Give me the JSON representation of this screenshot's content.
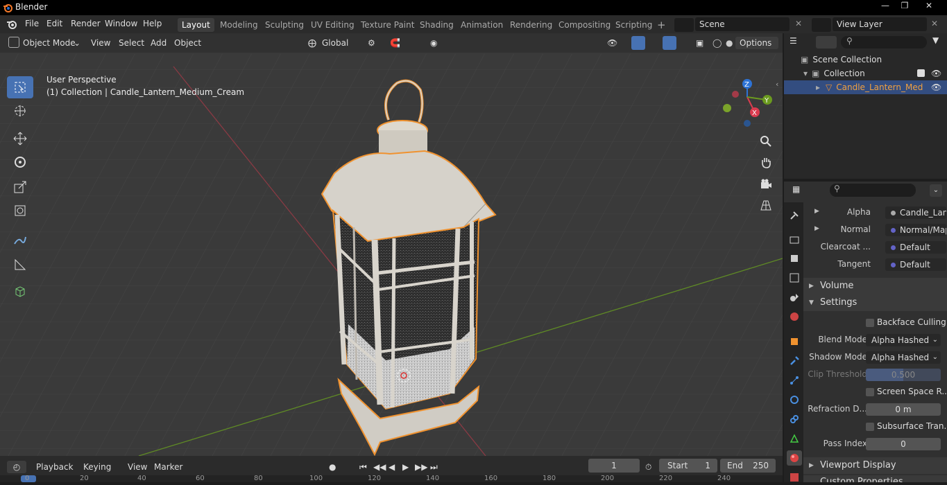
{
  "app": {
    "title": "Blender"
  },
  "menu": [
    "File",
    "Edit",
    "Render",
    "Window",
    "Help"
  ],
  "workspaces": [
    "Layout",
    "Modeling",
    "Sculpting",
    "UV Editing",
    "Texture Paint",
    "Shading",
    "Animation",
    "Rendering",
    "Compositing",
    "Scripting"
  ],
  "scene": {
    "name": "Scene",
    "view_layer": "View Layer"
  },
  "viewport": {
    "mode": "Object Mode",
    "menus": [
      "View",
      "Select",
      "Add",
      "Object"
    ],
    "transform_orientation": "Global",
    "options": "Options",
    "perspective_label": "User Perspective",
    "collection_label": "(1) Collection | Candle_Lantern_Medium_Cream"
  },
  "gizmo": {
    "x": "X",
    "y": "Y",
    "z": "Z"
  },
  "outliner": {
    "root": "Scene Collection",
    "collection": "Collection",
    "object": "Candle_Lantern_Med"
  },
  "properties": {
    "rows": [
      {
        "label": "Alpha",
        "value": "Candle_Lante..."
      },
      {
        "label": "Normal",
        "value": "Normal/Map"
      },
      {
        "label": "Clearcoat ...",
        "value": "Default"
      },
      {
        "label": "Tangent",
        "value": "Default"
      }
    ],
    "sections": {
      "volume": "Volume",
      "settings": "Settings",
      "viewport_display": "Viewport Display",
      "custom_properties": "Custom Properties"
    },
    "settings": {
      "backface_culling": "Backface Culling",
      "blend_mode_label": "Blend Mode",
      "blend_mode": "Alpha Hashed",
      "shadow_mode_label": "Shadow Mode",
      "shadow_mode": "Alpha Hashed",
      "clip_threshold_label": "Clip Threshold",
      "clip_threshold": "0.500",
      "ssr": "Screen Space R...",
      "refraction_label": "Refraction D...",
      "refraction": "0 m",
      "subsurface": "Subsurface Tran...",
      "pass_index_label": "Pass Index",
      "pass_index": "0"
    }
  },
  "timeline": {
    "playback": "Playback",
    "keying": "Keying",
    "view": "View",
    "marker": "Marker",
    "current_frame": "1",
    "start_label": "Start",
    "start": "1",
    "end_label": "End",
    "end": "250",
    "ticks": [
      "0",
      "20",
      "40",
      "60",
      "80",
      "100",
      "120",
      "140",
      "160",
      "180",
      "200",
      "220",
      "240"
    ]
  },
  "colors": {
    "accent": "#4772b3",
    "selection": "#f0922f",
    "x_axis": "#db3b4f",
    "y_axis": "#6b9a1f",
    "z_axis": "#2d73d6"
  }
}
